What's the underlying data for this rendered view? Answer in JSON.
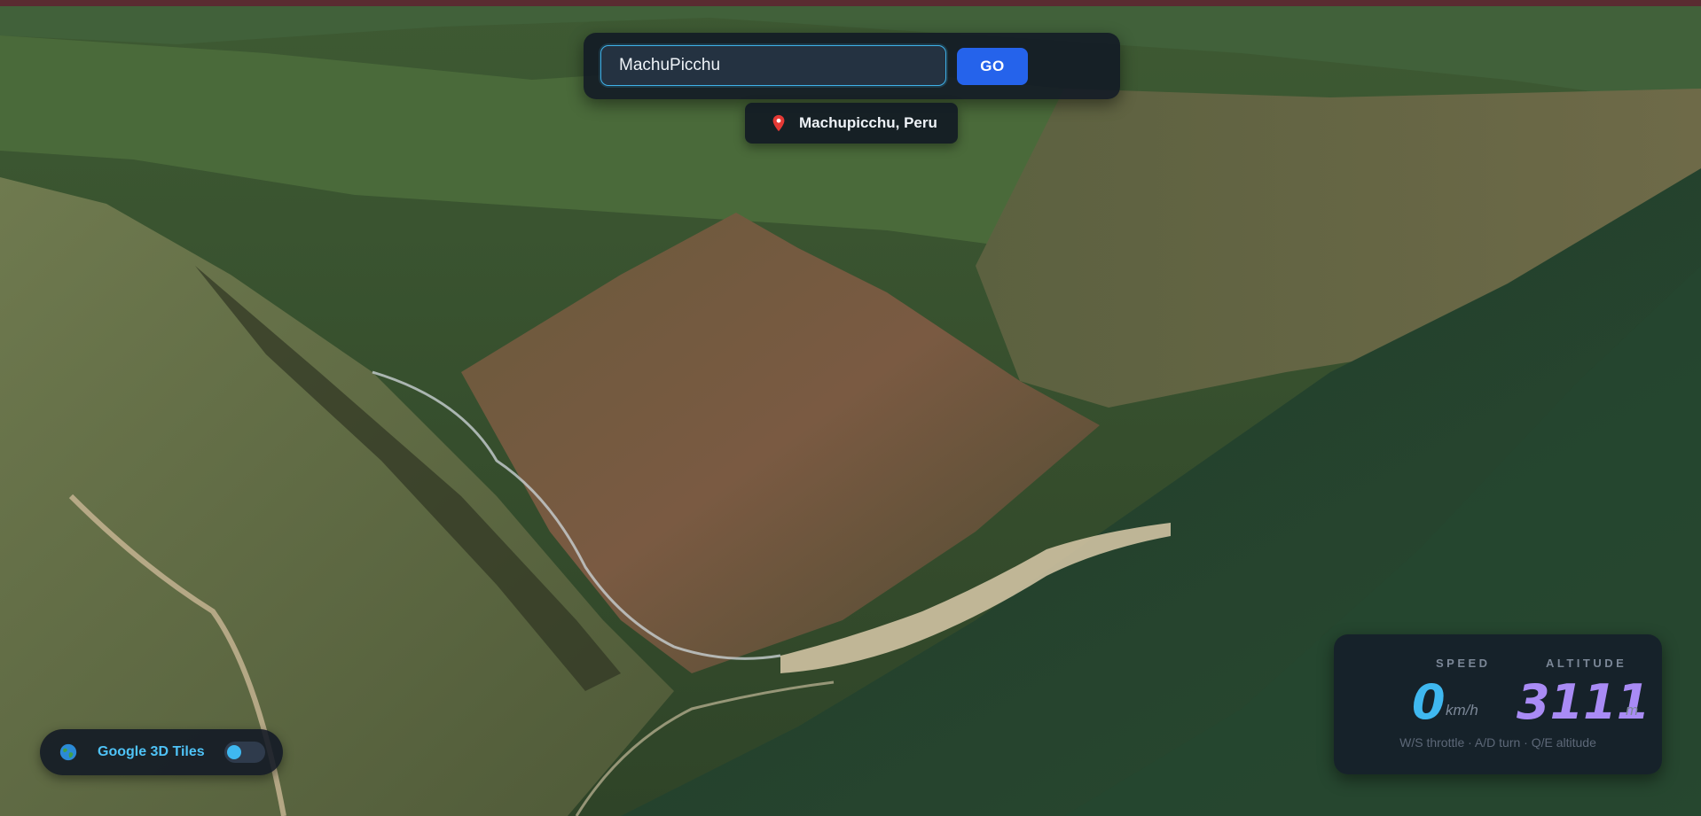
{
  "search": {
    "value": "MachuPicchu",
    "go_label": "GO"
  },
  "suggestion": {
    "icon": "map-pin-icon",
    "label": "Machupicchu, Peru"
  },
  "tiles": {
    "icon": "globe-icon",
    "label": "Google 3D Tiles",
    "enabled": false
  },
  "dashboard": {
    "speed_label": "SPEED",
    "speed_value": "0",
    "speed_unit": "km/h",
    "altitude_label": "ALTITUDE",
    "altitude_value": "3111",
    "altitude_unit": "m",
    "controls_hint": "W/S throttle · A/D turn · Q/E altitude"
  },
  "colors": {
    "accent": "#2563eb",
    "speed": "#3fb8f0",
    "altitude": "#a98bf5",
    "panel": "#111824"
  }
}
